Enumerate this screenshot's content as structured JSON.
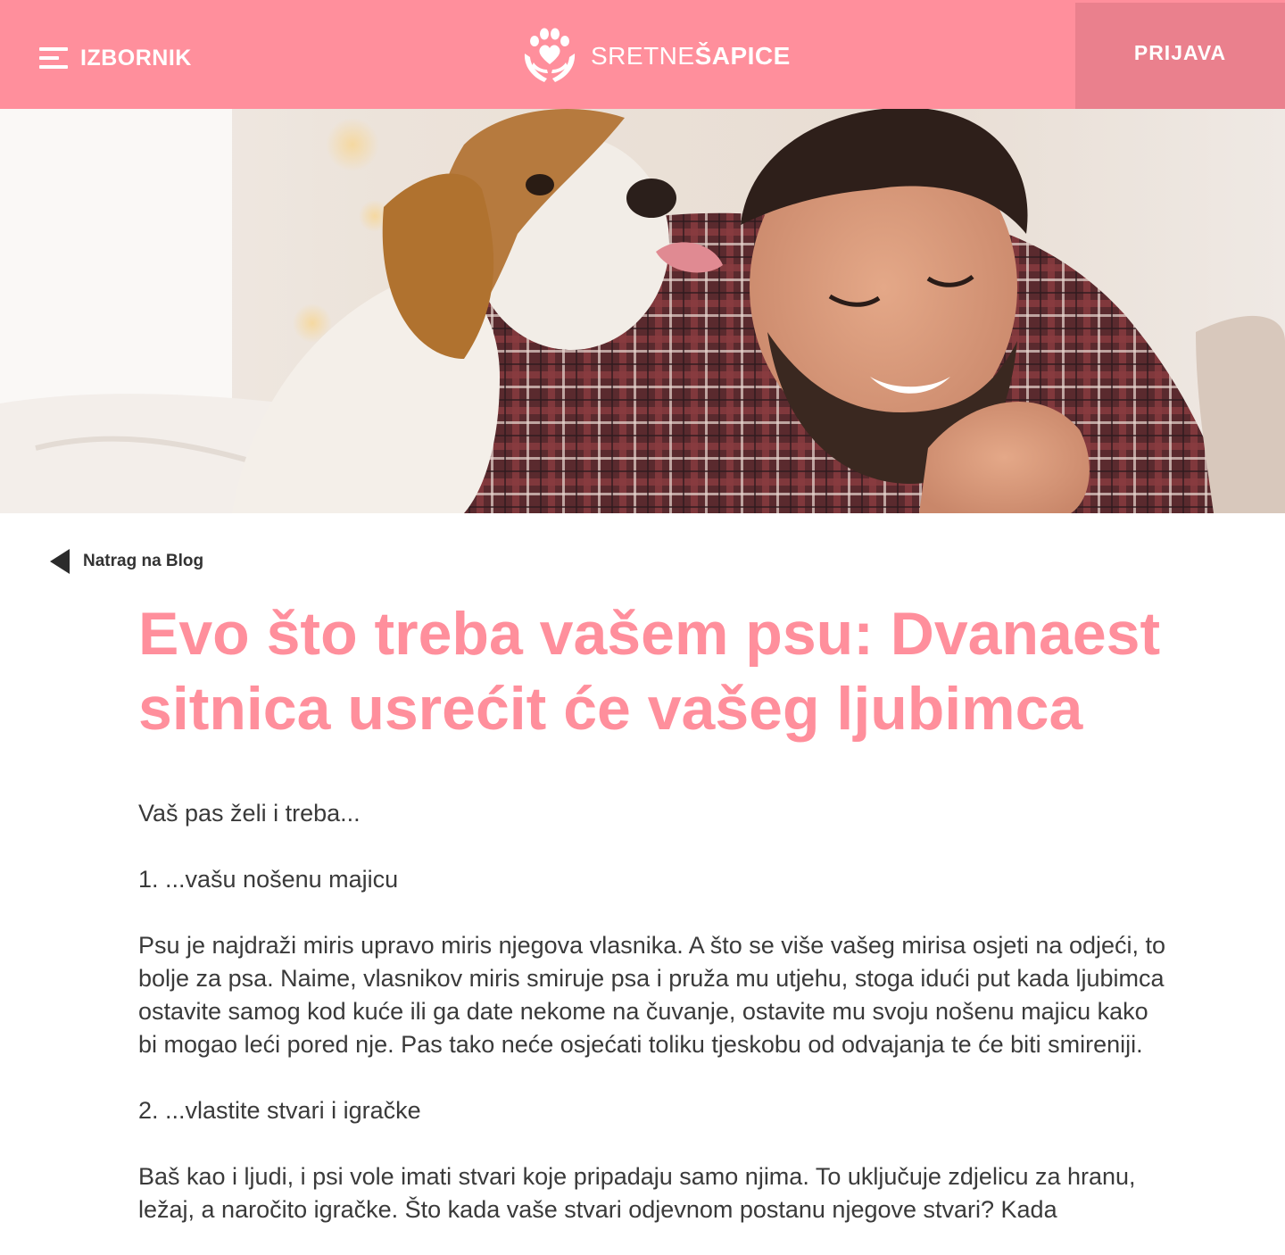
{
  "header": {
    "menu_label": "IZBORNIK",
    "logo_light": "SRETNE",
    "logo_bold": "ŠAPICE",
    "login_label": "PRIJAVA"
  },
  "colors": {
    "brand_pink": "#ff8f9c",
    "login_bg": "#ea808d",
    "text": "#3a3a3a"
  },
  "back_link": {
    "label": "Natrag na Blog"
  },
  "article": {
    "title": "Evo što treba vašem psu: Dvanaest sitnica usrećit će vašeg ljubimca",
    "paragraphs": [
      "Vaš pas želi i treba...",
      "1. ...vašu nošenu majicu",
      "Psu je najdraži miris upravo miris njegova vlasnika. A što se više vašeg mirisa osjeti na odjeći, to bolje za psa. Naime, vlasnikov miris smiruje psa i pruža mu utjehu, stoga idući put kada ljubimca ostavite samog kod kuće ili ga date nekome na čuvanje, ostavite mu svoju nošenu majicu kako bi mogao leći pored nje. Pas tako neće osjećati toliku tjeskobu od odvajanja te će biti smireniji.",
      "2. ...vlastite stvari i igračke",
      "Baš kao i ljudi, i psi vole imati stvari koje pripadaju samo njima. To uključuje zdjelicu za hranu, ležaj, a naročito igračke. Što kada vaše stvari odjevnom postanu njegove stvari? Kada"
    ]
  }
}
